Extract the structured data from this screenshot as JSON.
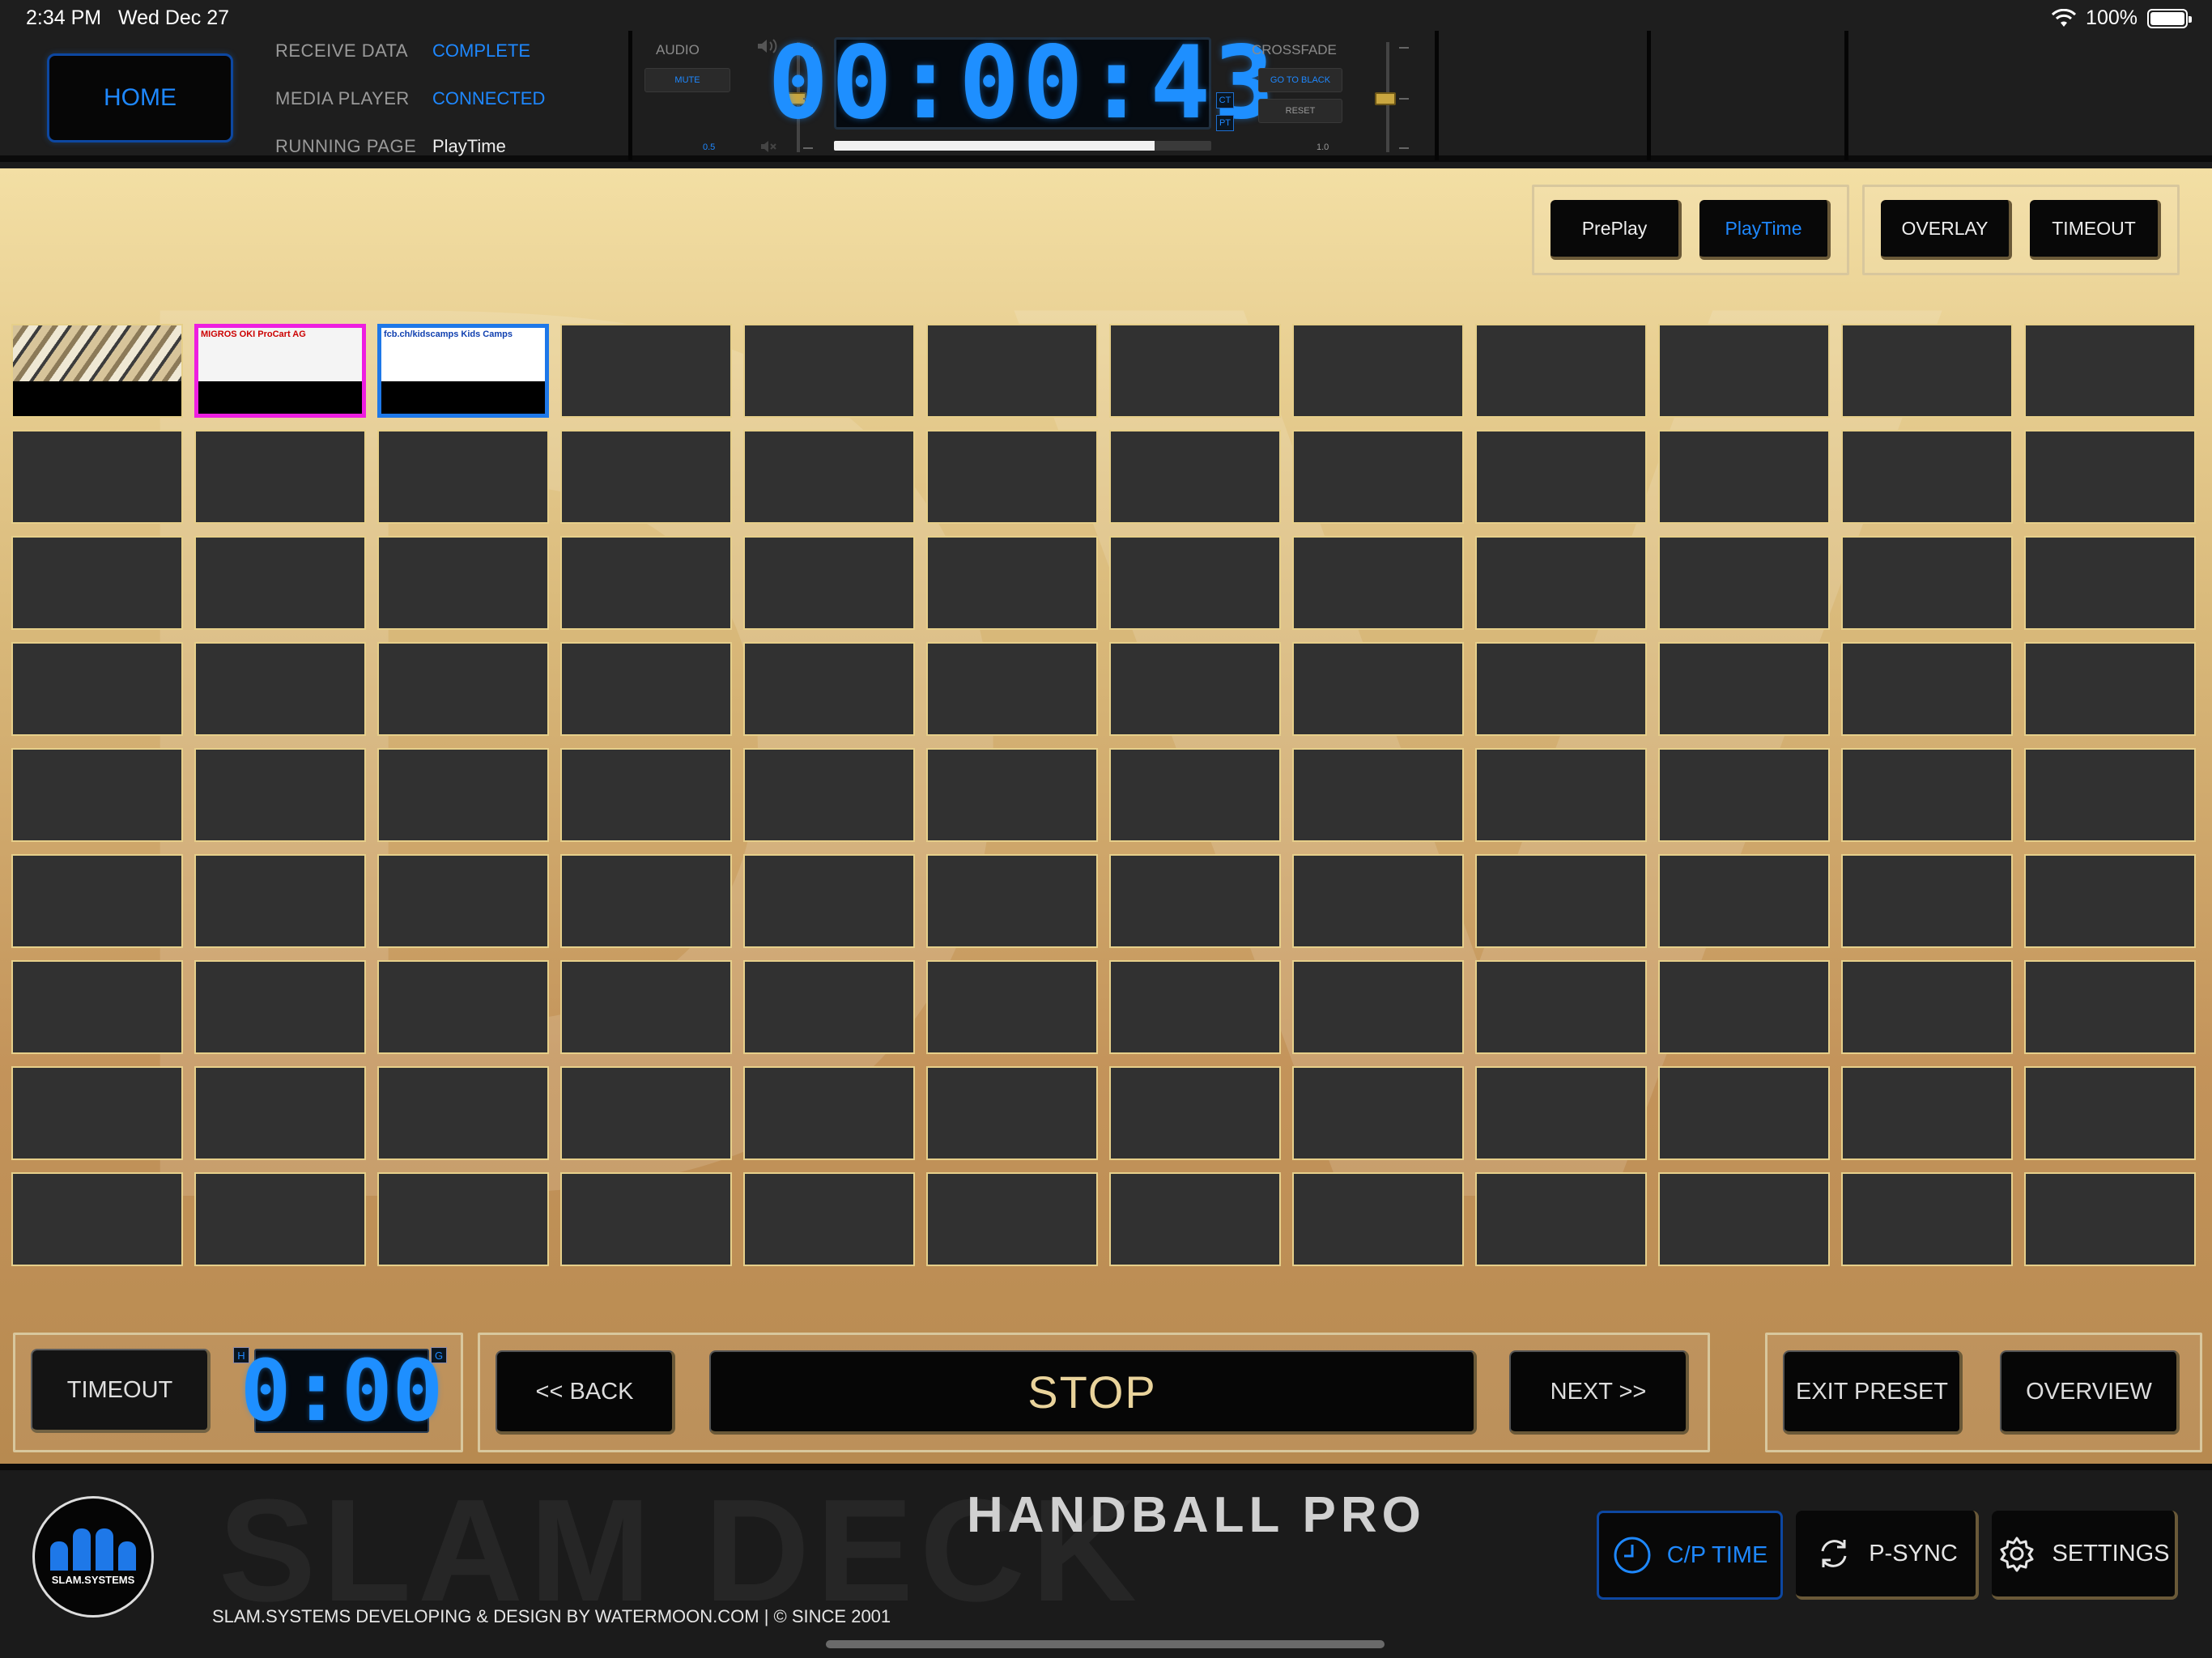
{
  "status_bar": {
    "time": "2:34 PM",
    "date": "Wed Dec 27",
    "battery": "100%"
  },
  "header": {
    "home_label": "HOME",
    "rows": [
      {
        "label": "RECEIVE DATA",
        "value": "COMPLETE"
      },
      {
        "label": "MEDIA PLAYER",
        "value": "CONNECTED"
      },
      {
        "label": "RUNNING PAGE",
        "value": "PlayTime"
      }
    ],
    "audio": {
      "label": "AUDIO",
      "mute_label": "MUTE",
      "level": "0.5"
    },
    "clock": {
      "time": "00:00:43",
      "ct_label": "CT",
      "pt_label": "PT",
      "progress": 0.85
    },
    "crossfade": {
      "label": "CROSSFADE",
      "go_to_black_label": "GO TO BLACK",
      "reset_label": "RESET",
      "level": "1.0"
    }
  },
  "banks": {
    "group1": [
      {
        "label": "PrePlay",
        "active": false
      },
      {
        "label": "PlayTime",
        "active": true
      }
    ],
    "group2": [
      {
        "label": "OVERLAY",
        "active": false
      },
      {
        "label": "TIMEOUT",
        "active": false
      }
    ]
  },
  "grid": {
    "cols": 12,
    "rows": 9,
    "thumbnails": [
      {
        "text": ""
      },
      {
        "text": "MIGROS OKI ProCart AG"
      },
      {
        "text": "fcb.ch/kidscamps Kids Camps"
      }
    ]
  },
  "controls": {
    "timeout_label": "TIMEOUT",
    "timeout_clock": "0:00",
    "h_label": "H",
    "g_label": "G",
    "back_label": "<< BACK",
    "stop_label": "STOP",
    "next_label": "NEXT >>",
    "exit_preset_label": "EXIT PRESET",
    "overview_label": "OVERVIEW"
  },
  "footer": {
    "logo_text": "SLAM.SYSTEMS",
    "bg_text": "SLAM DECK",
    "product_name": "HANDBALL PRO",
    "credit": "SLAM.SYSTEMS DEVELOPING & DESIGN BY WATERMOON.COM | © SINCE 2001",
    "buttons": [
      {
        "label": "C/P TIME",
        "icon": "clock-icon",
        "active": true
      },
      {
        "label": "P-SYNC",
        "icon": "sync-icon",
        "active": false
      },
      {
        "label": "SETTINGS",
        "icon": "gear-icon",
        "active": false
      }
    ]
  },
  "colors": {
    "accent": "#1e88ff",
    "gold": "#e6cf8a",
    "selection_magenta": "#ee1ee0",
    "selection_blue": "#1e78e8"
  }
}
